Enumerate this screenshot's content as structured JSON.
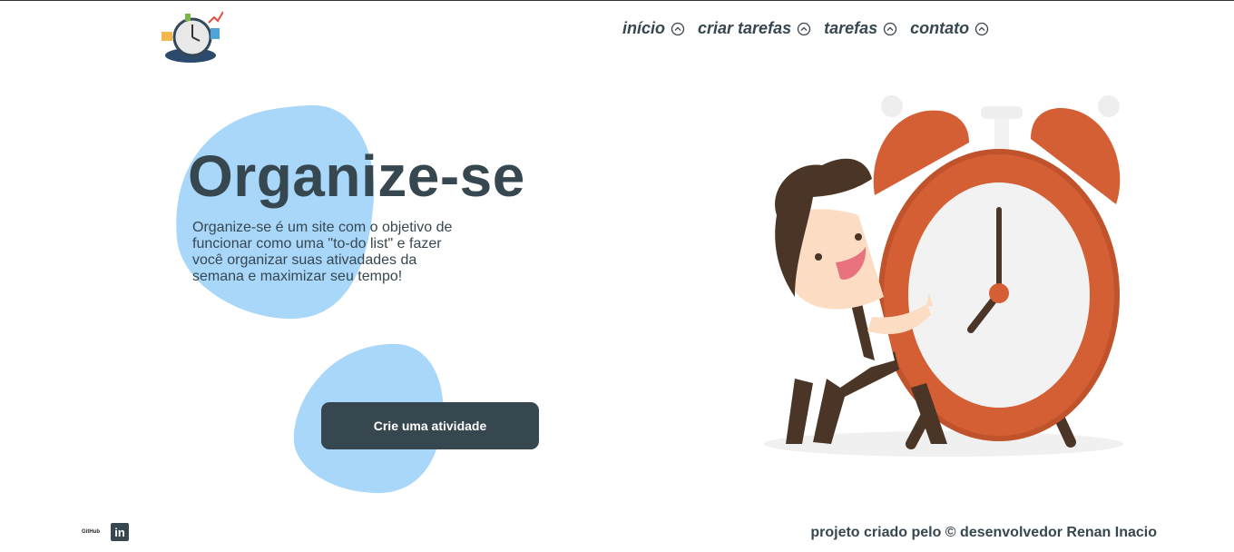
{
  "nav": {
    "items": [
      {
        "label": "início"
      },
      {
        "label": "criar tarefas"
      },
      {
        "label": "tarefas"
      },
      {
        "label": "contato"
      }
    ]
  },
  "hero": {
    "title": "Organize-se",
    "description": "Organize-se é um site com o objetivo de funcionar como uma \"to-do list\" e fazer você organizar suas ativadades da semana e maximizar seu tempo!",
    "cta_label": "Crie uma atividade"
  },
  "footer": {
    "github_label": "GitHub",
    "linkedin_label": "in",
    "credits": "projeto criado pelo © desenvolvedor Renan Inacio"
  },
  "colors": {
    "primary": "#37474f",
    "blob": "#a8d7fa",
    "clock": "#d55f34"
  }
}
